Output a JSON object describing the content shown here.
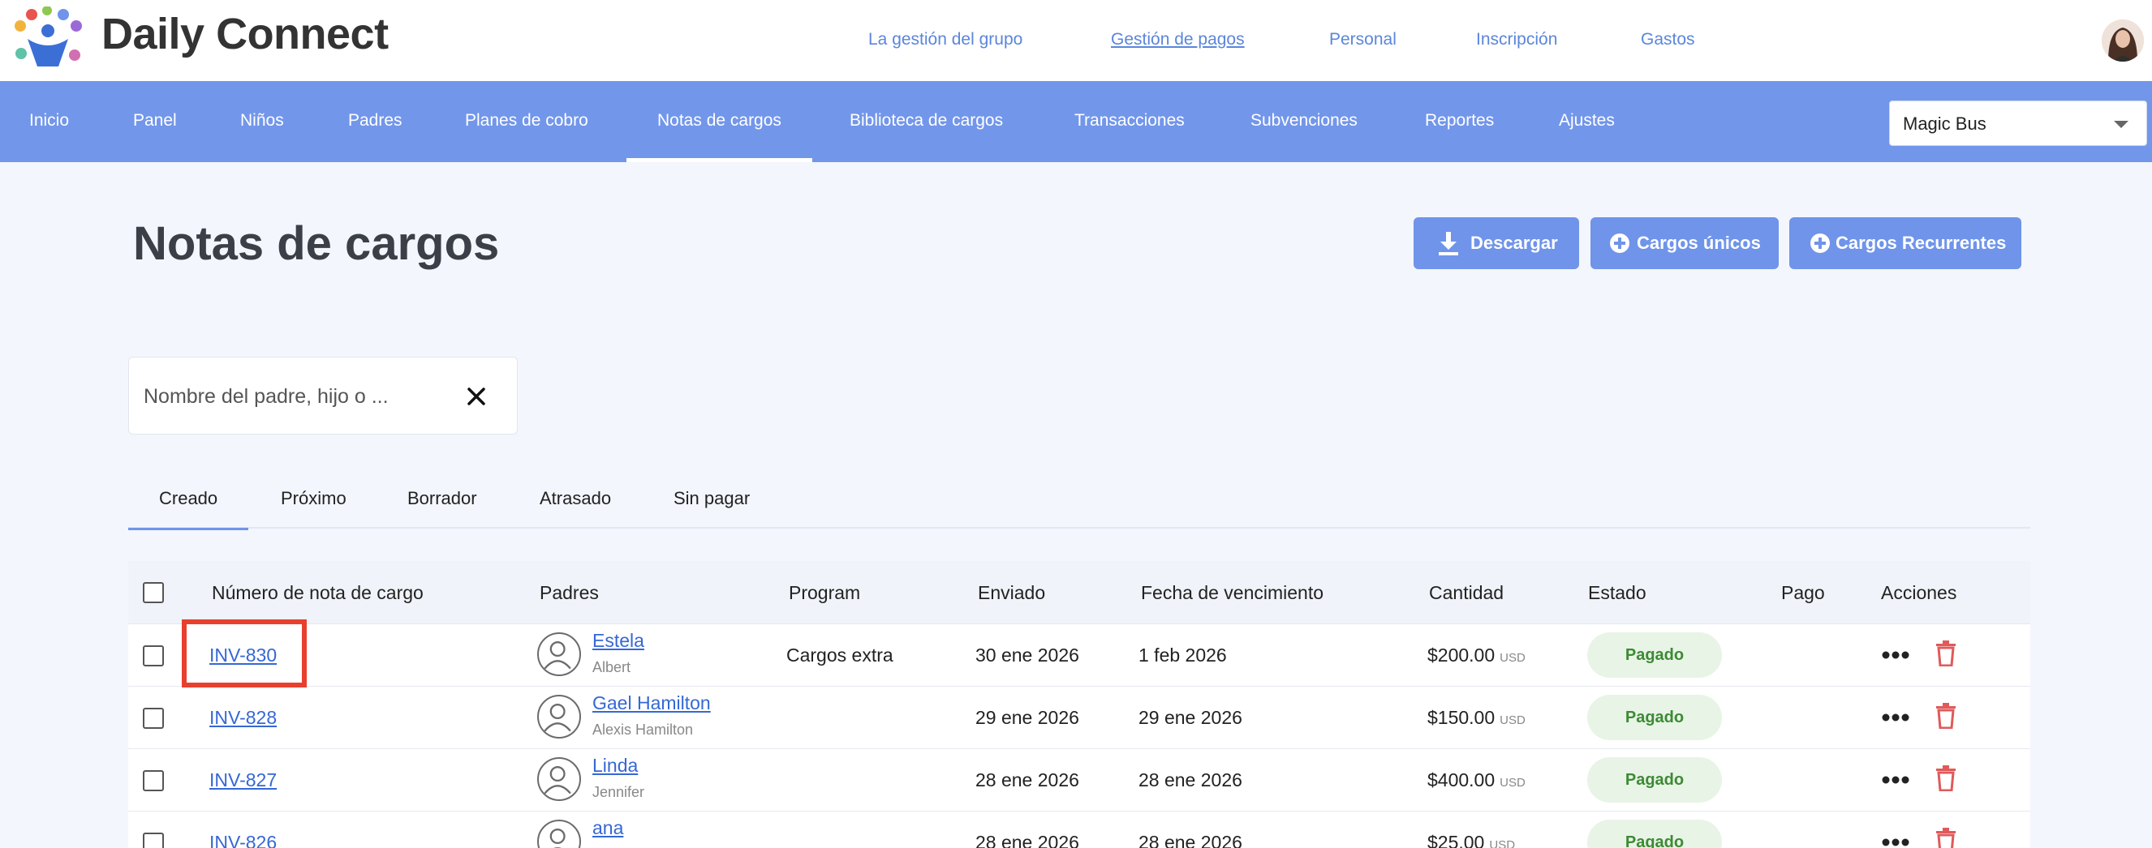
{
  "brand": {
    "name": "Daily Connect"
  },
  "top_links": [
    {
      "label": "La gestión del grupo",
      "active": false
    },
    {
      "label": "Gestión de pagos",
      "active": true
    },
    {
      "label": "Personal",
      "active": false
    },
    {
      "label": "Inscripción",
      "active": false
    },
    {
      "label": "Gastos",
      "active": false
    }
  ],
  "nav": {
    "items": [
      {
        "label": "Inicio",
        "active": false
      },
      {
        "label": "Panel",
        "active": false
      },
      {
        "label": "Niños",
        "active": false
      },
      {
        "label": "Padres",
        "active": false
      },
      {
        "label": "Planes de cobro",
        "active": false
      },
      {
        "label": "Notas de cargos",
        "active": true
      },
      {
        "label": "Biblioteca de cargos",
        "active": false
      },
      {
        "label": "Transacciones",
        "active": false
      },
      {
        "label": "Subvenciones",
        "active": false
      },
      {
        "label": "Reportes",
        "active": false
      },
      {
        "label": "Ajustes",
        "active": false
      }
    ],
    "org_selector": {
      "value": "Magic Bus"
    }
  },
  "page": {
    "title": "Notas de cargos",
    "buttons": {
      "download": "Descargar",
      "one_time": "Cargos únicos",
      "recurring": "Cargos Recurrentes"
    }
  },
  "search": {
    "placeholder": "Nombre del padre, hijo o ..."
  },
  "tabs": [
    {
      "label": "Creado",
      "active": true
    },
    {
      "label": "Próximo",
      "active": false
    },
    {
      "label": "Borrador",
      "active": false
    },
    {
      "label": "Atrasado",
      "active": false
    },
    {
      "label": "Sin pagar",
      "active": false
    }
  ],
  "table": {
    "columns": {
      "invoice": "Número de nota de cargo",
      "parents": "Padres",
      "program": "Program",
      "sent": "Enviado",
      "due": "Fecha de vencimiento",
      "amount": "Cantidad",
      "status": "Estado",
      "payment": "Pago",
      "actions": "Acciones"
    },
    "rows": [
      {
        "invoice": "INV-830",
        "parent": "Estela",
        "child": "Albert",
        "program": "Cargos extra",
        "sent": "30 ene 2026",
        "due": "1 feb 2026",
        "amount": "$200.00",
        "currency": "USD",
        "status": "Pagado"
      },
      {
        "invoice": "INV-828",
        "parent": "Gael Hamilton",
        "child": "Alexis Hamilton",
        "program": "",
        "sent": "29 ene 2026",
        "due": "29 ene 2026",
        "amount": "$150.00",
        "currency": "USD",
        "status": "Pagado"
      },
      {
        "invoice": "INV-827",
        "parent": "Linda",
        "child": "Jennifer",
        "program": "",
        "sent": "28 ene 2026",
        "due": "28 ene 2026",
        "amount": "$400.00",
        "currency": "USD",
        "status": "Pagado"
      },
      {
        "invoice": "INV-826",
        "parent": "ana",
        "child": "",
        "program": "",
        "sent": "28 ene 2026",
        "due": "28 ene 2026",
        "amount": "$25.00",
        "currency": "USD",
        "status": "Pagado"
      }
    ]
  },
  "colors": {
    "nav_bg": "#7296ea",
    "button_bg": "#6f94ea",
    "link": "#3568d4",
    "badge_bg": "#e8f4e6",
    "badge_text": "#3d8a35",
    "delete": "#e05a5a",
    "highlight": "#e8402f"
  }
}
